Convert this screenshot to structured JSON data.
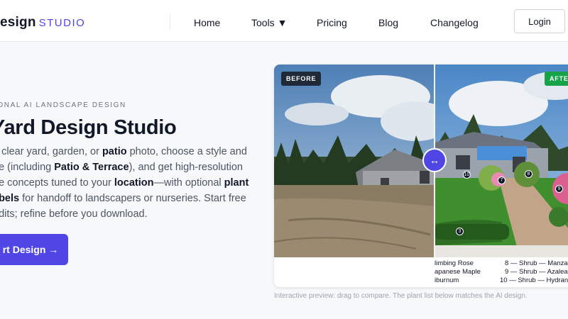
{
  "header": {
    "brand_main": "esign",
    "brand_sub": "STUDIO",
    "nav": [
      "Home",
      "Tools ▼",
      "Pricing",
      "Blog",
      "Changelog"
    ],
    "login": "Login"
  },
  "hero": {
    "eyebrow": "IONAL AI LANDSCAPE DESIGN",
    "title": "Yard Design Studio",
    "desc": {
      "l1a": "a clear yard, garden, or ",
      "l1b": "patio",
      "l1c": " photo, choose a style and",
      "l2a": "pe (including ",
      "l2b": "Patio & Terrace",
      "l2c": "), and get high-resolution",
      "l3a": "pe concepts tuned to your ",
      "l3b": "location",
      "l3c": "—with optional ",
      "l3d": "plant",
      "l4a": "abels",
      "l4b": " for handoff to landscapers or nurseries. Start free",
      "l5": "edits; refine before you download."
    },
    "cta": "rt Design →"
  },
  "compare": {
    "before_label": "BEFORE",
    "after_label": "AFTE",
    "handle_icon": "↔",
    "markers": [
      "10",
      "7",
      "8",
      "3",
      "9"
    ],
    "plant_list_left": [
      "limbing Rose",
      "apanese Maple",
      "iburnum"
    ],
    "plant_list_right": [
      "8 — Shrub — Manzani",
      "9 — Shrub — Azalea",
      "10 — Shrub — Hydrang"
    ]
  },
  "caption": "Interactive preview: drag to compare. The plant list below matches the AI design.",
  "colors": {
    "accent": "#4f46e5",
    "after_badge": "#16a34a",
    "before_badge": "#1f2937"
  }
}
